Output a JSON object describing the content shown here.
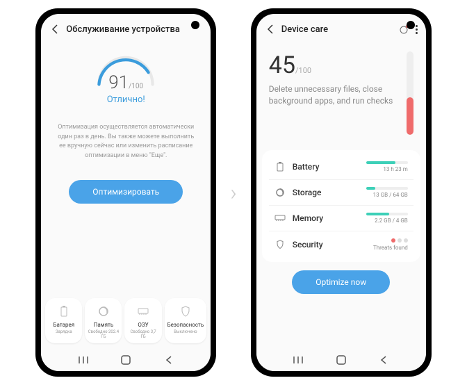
{
  "left": {
    "title": "Обслуживание устройства",
    "score": "91",
    "score_max": "/100",
    "score_label": "Отлично!",
    "desc": "Оптимизация осуществляется автоматически один раз в день. Вы также можете выполнить ее вручную сейчас или изменить расписание оптимизации в меню \"Еще\".",
    "btn": "Оптимизировать",
    "tiles": [
      {
        "label": "Батарея",
        "sub": "Зарядка"
      },
      {
        "label": "Память",
        "sub": "Свободно 202.4 ГБ"
      },
      {
        "label": "ОЗУ",
        "sub": "Свободно 3,7 ГБ"
      },
      {
        "label": "Безопасность",
        "sub": "Выключено"
      }
    ]
  },
  "right": {
    "title": "Device care",
    "score": "45",
    "score_max": "/100",
    "advice": "Delete unnecessary files, close background apps, and run checks",
    "cards": [
      {
        "label": "Battery",
        "value": "13 h 23 m",
        "fill": 70,
        "color": "#3dd0b8"
      },
      {
        "label": "Storage",
        "value": "13 GB / 64 GB",
        "fill": 22,
        "color": "#3dd0b8"
      },
      {
        "label": "Memory",
        "value": "2.2 GB / 4 GB",
        "fill": 55,
        "color": "#3dd0b8"
      },
      {
        "label": "Security",
        "value": "Threats found"
      }
    ],
    "btn": "Optimize now"
  }
}
